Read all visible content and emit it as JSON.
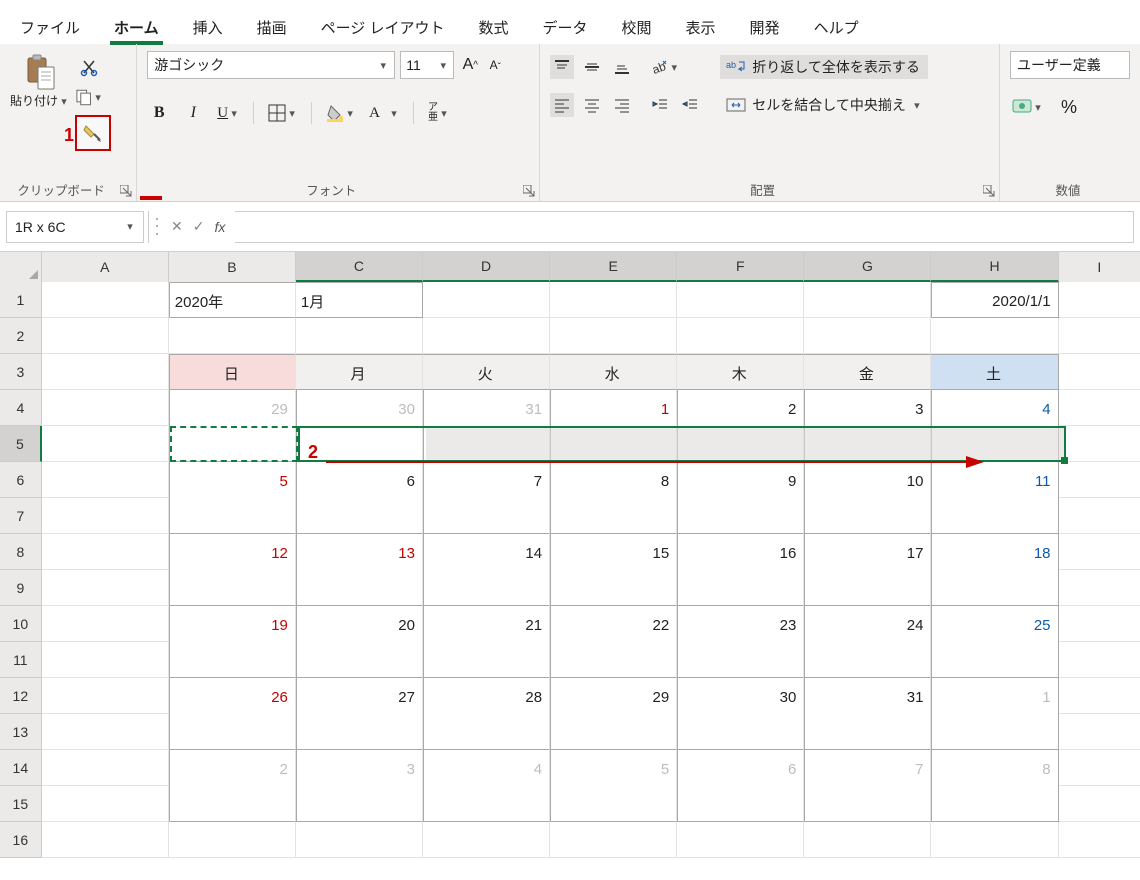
{
  "tabs": {
    "file": "ファイル",
    "home": "ホーム",
    "insert": "挿入",
    "draw": "描画",
    "layout": "ページ レイアウト",
    "formulas": "数式",
    "data": "データ",
    "review": "校閲",
    "view": "表示",
    "developer": "開発",
    "help": "ヘルプ"
  },
  "ribbon": {
    "clipboard": {
      "paste": "貼り付け",
      "groupLabel": "クリップボード"
    },
    "font": {
      "name": "游ゴシック",
      "size": "11",
      "bold": "B",
      "italic": "I",
      "underline": "U",
      "phonetic": "ア\n亜",
      "groupLabel": "フォント"
    },
    "alignment": {
      "wrap": "折り返して全体を表示する",
      "merge": "セルを結合して中央揃え",
      "groupLabel": "配置"
    },
    "number": {
      "format": "ユーザー定義",
      "groupLabel": "数値",
      "percent": "%"
    }
  },
  "formulaBar": {
    "nameBox": "1R x 6C",
    "fx": "fx",
    "value": ""
  },
  "columns": [
    "A",
    "B",
    "C",
    "D",
    "E",
    "F",
    "G",
    "H",
    "I"
  ],
  "rowNums": [
    "1",
    "2",
    "3",
    "4",
    "5",
    "6",
    "7",
    "8",
    "9",
    "10",
    "11",
    "12",
    "13",
    "14",
    "15",
    "16"
  ],
  "cells": {
    "B1": "2020年",
    "C1": "1月",
    "H1": "2020/1/1",
    "dayHeaders": {
      "sun": "日",
      "mon": "月",
      "tue": "火",
      "wed": "水",
      "thu": "木",
      "fri": "金",
      "sat": "土"
    },
    "w1": {
      "B": "29",
      "C": "30",
      "D": "31",
      "E": "1",
      "F": "2",
      "G": "3",
      "H": "4"
    },
    "w2": {
      "B": "5",
      "C": "6",
      "D": "7",
      "E": "8",
      "F": "9",
      "G": "10",
      "H": "11"
    },
    "w3": {
      "B": "12",
      "C": "13",
      "D": "14",
      "E": "15",
      "F": "16",
      "G": "17",
      "H": "18"
    },
    "w4": {
      "B": "19",
      "C": "20",
      "D": "21",
      "E": "22",
      "F": "23",
      "G": "24",
      "H": "25"
    },
    "w5": {
      "B": "26",
      "C": "27",
      "D": "28",
      "E": "29",
      "F": "30",
      "G": "31",
      "H": "1"
    },
    "w6": {
      "B": "2",
      "C": "3",
      "D": "4",
      "E": "5",
      "F": "6",
      "G": "7",
      "H": "8"
    }
  },
  "annotations": {
    "n1": "1",
    "n2": "2"
  }
}
